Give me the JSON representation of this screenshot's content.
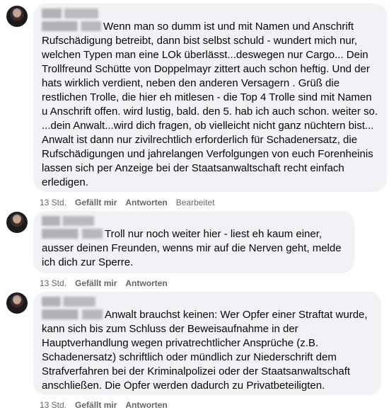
{
  "comments": [
    {
      "text": "Wenn man so dumm ist und mit Namen und Anschrift Rufschädigung betreibt, dann bist selbst schuld - wundert mich nur, welchen Typen man eine LOk überlässt...deswegen nur Cargo... Dein Trollfreund Schütte von Doppelmayr zittert auch schon heftig. Und der hats wirklich verdient, neben den anderen Versagern . Grüß die restlichen Trolle, die hier eh mitlesen - die Top 4 Trolle sind mit Namen u Anschrift offen. wird lustig, bald. den 5. hab ich auch schon. weiter so. ...dein Anwalt...wird dich fragen, ob vielleicht nicht ganz nüchtern bist... Anwalt ist dann nur zivilrechtlich erforderlich für Schadenersatz, die Rufschädigungen und jahrelangen Verfolgungen von euch Forenheinis lassen sich per Anzeige bei der Staatsanwaltschaft recht einfach erledigen.",
      "time": "13 Std.",
      "like": "Gefällt mir",
      "reply": "Antworten",
      "edited": "Bearbeitet"
    },
    {
      "text": "Troll nur noch weiter hier - liest eh kaum einer, ausser deinen Freunden, wenns mir auf die Nerven geht, melde ich dich zur Sperre.",
      "time": "13 Std.",
      "like": "Gefällt mir",
      "reply": "Antworten"
    },
    {
      "text": "Anwalt brauchst keinen: Wer Opfer einer Straftat wurde, kann sich bis zum Schluss der Beweisaufnahme in der Hauptverhandlung wegen privatrechtlicher Ansprüche (z.B. Schadenersatz) schriftlich oder mündlich zur Niederschrift dem Strafverfahren bei der Kriminalpolizei oder der Staatsanwaltschaft anschließen. Die Opfer werden dadurch zu Privatbeteiligten.",
      "time": "13 Std.",
      "like": "Gefällt mir",
      "reply": "Antworten"
    }
  ]
}
